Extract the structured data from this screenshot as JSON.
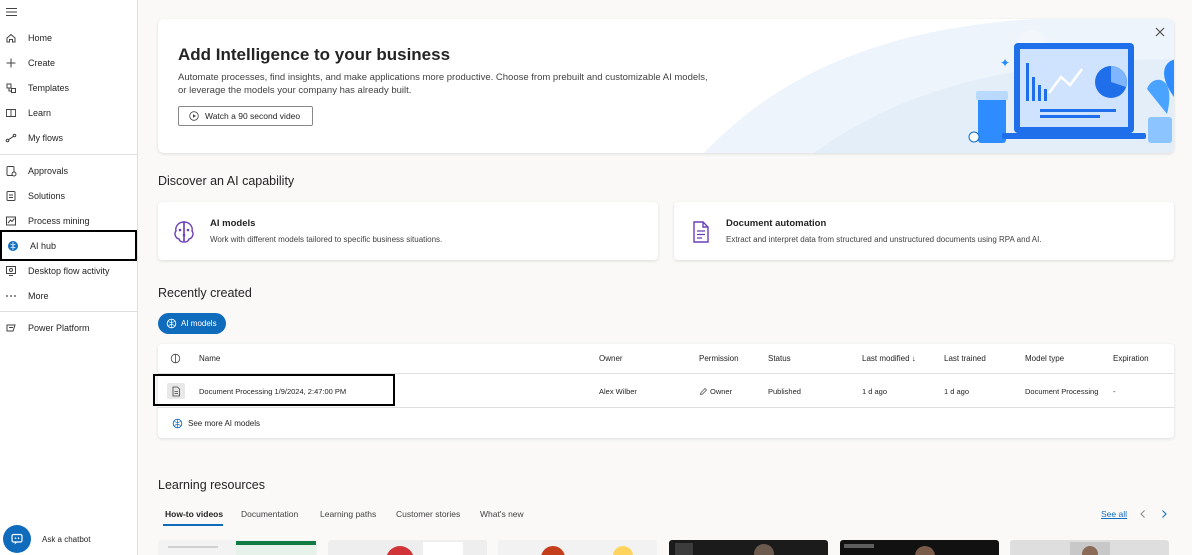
{
  "sidebar": {
    "items": [
      {
        "label": "Home"
      },
      {
        "label": "Create"
      },
      {
        "label": "Templates"
      },
      {
        "label": "Learn"
      },
      {
        "label": "My flows"
      },
      {
        "label": "Approvals"
      },
      {
        "label": "Solutions"
      },
      {
        "label": "Process mining"
      },
      {
        "label": "AI hub"
      },
      {
        "label": "Desktop flow activity"
      },
      {
        "label": "More"
      },
      {
        "label": "Power Platform"
      }
    ],
    "chatbot_label": "Ask a chatbot"
  },
  "hero": {
    "title": "Add Intelligence to your business",
    "description": "Automate processes, find insights, and make applications more productive. Choose from prebuilt and customizable AI models, or leverage the models your company has already built.",
    "button_label": "Watch a 90 second video"
  },
  "discover": {
    "title": "Discover an AI capability",
    "cards": [
      {
        "title": "AI models",
        "description": "Work with different models tailored to specific business situations."
      },
      {
        "title": "Document automation",
        "description": "Extract and interpret data from structured and unstructured documents using RPA and AI."
      }
    ]
  },
  "recent": {
    "title": "Recently created",
    "filter_label": "AI models",
    "columns": [
      "Name",
      "Owner",
      "Permission",
      "Status",
      "Last modified ↓",
      "Last trained",
      "Model type",
      "Expiration"
    ],
    "rows": [
      {
        "name": "Document Processing 1/9/2024, 2:47:00 PM",
        "owner": "Alex Wilber",
        "permission": "Owner",
        "status": "Published",
        "last_modified": "1 d ago",
        "last_trained": "1 d ago",
        "model_type": "Document Processing",
        "expiration": "-"
      }
    ],
    "see_more_label": "See more AI models"
  },
  "learning": {
    "title": "Learning resources",
    "tabs": [
      "How-to videos",
      "Documentation",
      "Learning paths",
      "Customer stories",
      "What's new"
    ],
    "see_all_label": "See all"
  },
  "colors": {
    "accent": "#0f6cbd",
    "background": "#faf9f8"
  }
}
